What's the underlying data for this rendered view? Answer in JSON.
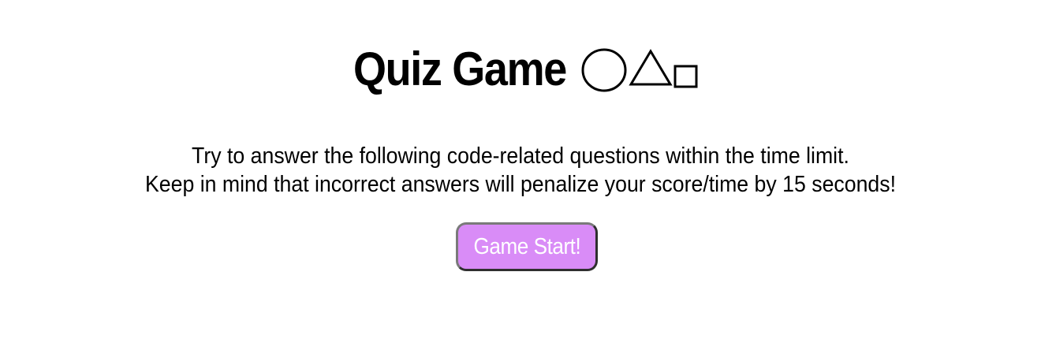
{
  "header": {
    "title": "Quiz Game",
    "shape_icons": [
      "circle-outline-icon",
      "triangle-outline-icon",
      "square-outline-icon"
    ]
  },
  "intro": {
    "line1": "Try to answer the following code-related questions within the time limit.",
    "line2": "Keep in mind that incorrect answers will penalize your score/time by 15 seconds!"
  },
  "start_button": {
    "label": "Game Start!"
  },
  "colors": {
    "background": "#ffffff",
    "text": "#000000",
    "button_fill": "#d98cf7",
    "button_text": "#ffffff",
    "button_border": "#2f2f2f"
  }
}
